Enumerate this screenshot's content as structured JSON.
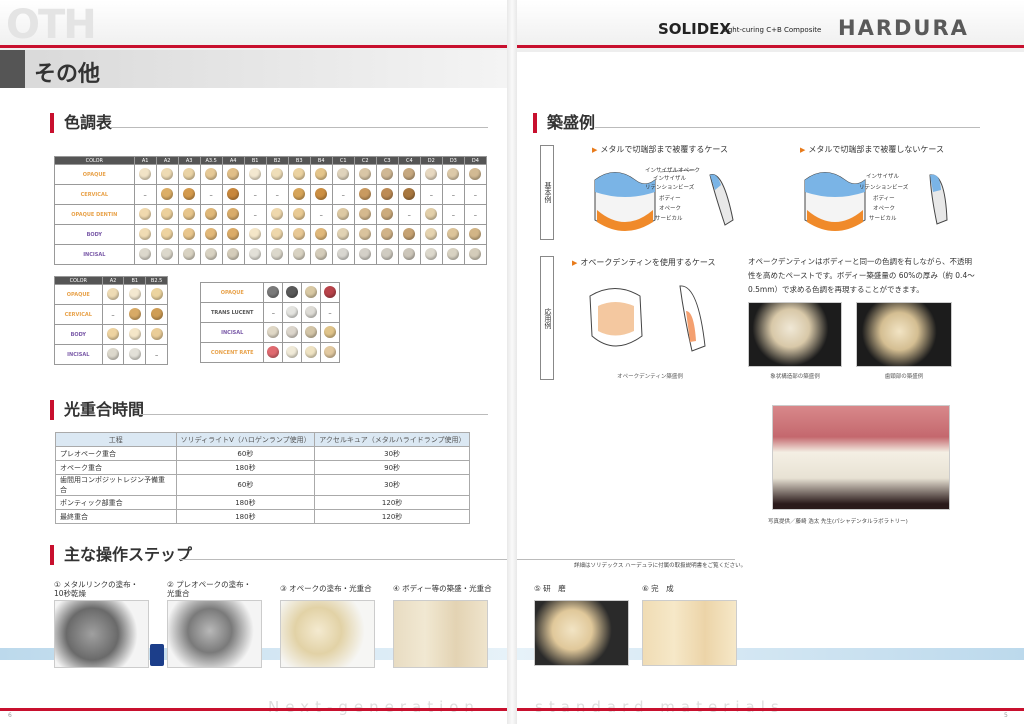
{
  "left_page": {
    "header_watermark": "OTH",
    "page_title": "その他",
    "sections": {
      "shade_table": "色調表",
      "cure_time": "光重合時間",
      "steps": "主な操作ステップ"
    },
    "page_number": "6"
  },
  "right_page": {
    "brand": "SOLIDEX",
    "brand_sub": "Light-curing C+B Composite",
    "logo": "HARDURA",
    "section_build": "築盛例",
    "basic_label": "基本例",
    "applied_label": "応用例",
    "case1": "メタルで切端部まで被覆するケース",
    "case2": "メタルで切端部まで被覆しないケース",
    "case3": "オペークデンティンを使用するケース",
    "case3_desc": "オペークデンティンはボディーと同一の色調を有しながら、不透明性を高めたペーストです。ボディー築盛量の 60%の厚み（約 0.4～0.5mm）で求める色調を再現することができます。",
    "layers1": [
      "インサイザルオペーク",
      "インサイザル",
      "リテンションビーズ",
      "ボディー",
      "オペーク",
      "サービカル"
    ],
    "layers2": [
      "インサイザル",
      "リテンションビーズ",
      "ボディー",
      "オペーク",
      "サービカル"
    ],
    "captions": [
      "オペークデンティン築盛例",
      "象状構造部の築盛例",
      "歯頸部の築盛例"
    ],
    "photo_credit": "写真提供／藤崎 浩太 先生(パシャデンタルラボラトリー)",
    "note": "詳細はソリデックス ハーデュラに付属の取扱説明書をご覧ください。",
    "page_number": "5"
  },
  "shade_table_main": {
    "header": [
      "COLOR",
      "A1",
      "A2",
      "A3",
      "A3.5",
      "A4",
      "B1",
      "B2",
      "B3",
      "B4",
      "C1",
      "C2",
      "C3",
      "C4",
      "D2",
      "D3",
      "D4"
    ],
    "rows": [
      {
        "label": "OPAQUE",
        "color": "#e8a24a",
        "chips": [
          "#f1e3c6",
          "#eedbb4",
          "#ead3a5",
          "#e6c996",
          "#e1bf88",
          "#f3e8d0",
          "#efdeb9",
          "#ebd2a0",
          "#e4c58b",
          "#dfd3bc",
          "#d9c6a6",
          "#d0b894",
          "#c6a87f",
          "#e7d8c0",
          "#dcc9a8",
          "#d2ba93"
        ]
      },
      {
        "label": "CERVICAL",
        "color": "#e8a24a",
        "chips": [
          "",
          "#dcae66",
          "#d49a4c",
          "",
          "#c8873c",
          "",
          "",
          "#d6a458",
          "#cc8f42",
          "",
          "#c99a60",
          "#bd8b55",
          "#a8773f",
          "",
          "",
          ""
        ]
      },
      {
        "label": "OPAQUE DENTIN",
        "color": "#e8a24a",
        "chips": [
          "#f0d9ae",
          "#ecd09c",
          "#e7c58b",
          "#e0b878",
          "#d9ac6a",
          "",
          "#efd8ad",
          "#e9ca93",
          "",
          "#ddc9a3",
          "#d5b98e",
          "#ccab7c",
          "",
          "#e2cfa9",
          "",
          ""
        ]
      },
      {
        "label": "BODY",
        "color": "#7a5aa8",
        "chips": [
          "#f0dcb4",
          "#eed3a0",
          "#e9c68c",
          "#e2b878",
          "#dbab67",
          "#f4e6c8",
          "#eed7ab",
          "#e8c894",
          "#e0b87a",
          "#e1d2b3",
          "#dac39d",
          "#d1b388",
          "#c6a272",
          "#e5d3af",
          "#dcc49a",
          "#d2b586"
        ]
      },
      {
        "label": "INCISAL",
        "color": "#7a5aa8",
        "chips": [
          "#dcd8cc",
          "#dcd8cc",
          "#d8d2c2",
          "#d8d2c2",
          "#d4ccba",
          "#e2e0d8",
          "#dcd8cc",
          "#d8d2c2",
          "#d4ccba",
          "#d8d6d0",
          "#d4d0c8",
          "#d0ccc2",
          "#ccc6ba",
          "#dcd8cc",
          "#d8d2c2",
          "#d4ccba"
        ]
      }
    ]
  },
  "shade_table_small": {
    "header": [
      "COLOR",
      "A2",
      "B1",
      "B2.5"
    ],
    "rows": [
      {
        "label": "OPAQUE",
        "color": "#e8a24a",
        "chips": [
          "#eedbb4",
          "#f3e8d0",
          "#ecd49f"
        ]
      },
      {
        "label": "CERVICAL",
        "color": "#e8a24a",
        "chips": [
          "",
          "#d8aa66",
          "#cf9d55"
        ]
      },
      {
        "label": "BODY",
        "color": "#7a5aa8",
        "chips": [
          "#eed3a0",
          "#f4e6c8",
          "#eacd98"
        ]
      },
      {
        "label": "INCISAL",
        "color": "#7a5aa8",
        "chips": [
          "#dcd8cc",
          "#e2e0d8",
          ""
        ]
      }
    ]
  },
  "shade_table_special": {
    "rows": [
      {
        "label": "OPAQUE",
        "color": "#e8a24a",
        "chips": [
          "#7a7a7a",
          "#5a5a5a",
          "#d9c9a4",
          "#b8434a"
        ]
      },
      {
        "label": "TRANS LUCENT",
        "color": "#555555",
        "chips": [
          "",
          "#e4e4e0",
          "#dedcd6",
          ""
        ]
      },
      {
        "label": "INCISAL",
        "color": "#7a5aa8",
        "chips": [
          "#e0d8c6",
          "#dcd6cc",
          "#d4c6a8",
          "#e0c48a"
        ]
      },
      {
        "label": "CONCENT RATE",
        "color": "#e8a24a",
        "chips": [
          "#e06a70",
          "#f0ead8",
          "#efe3c3",
          "#e2c9a0"
        ]
      }
    ]
  },
  "cure_table": {
    "columns": [
      "工程",
      "ソリディライトⅤ（ハロゲンランプ使用）",
      "アクセルキュア（メタルハライドランプ使用）"
    ],
    "rows": [
      [
        "プレオペーク重合",
        "60秒",
        "30秒"
      ],
      [
        "オペーク重合",
        "180秒",
        "90秒"
      ],
      [
        "歯間用コンポジットレジン予備重合",
        "60秒",
        "30秒"
      ],
      [
        "ポンティック部重合",
        "180秒",
        "120秒"
      ],
      [
        "最終重合",
        "180秒",
        "120秒"
      ]
    ]
  },
  "steps": [
    {
      "label": "① メタルリンクの塗布・\n10秒乾燥"
    },
    {
      "label": "② プレオペークの塗布・\n光重合"
    },
    {
      "label": "③ オペークの塗布・光重合"
    },
    {
      "label": "④ ボディー等の築盛・光重合"
    },
    {
      "label": "⑤ 研　磨"
    },
    {
      "label": "⑥ 完　成"
    }
  ],
  "footer": {
    "left": "Next-generation",
    "right": "standard materials"
  }
}
